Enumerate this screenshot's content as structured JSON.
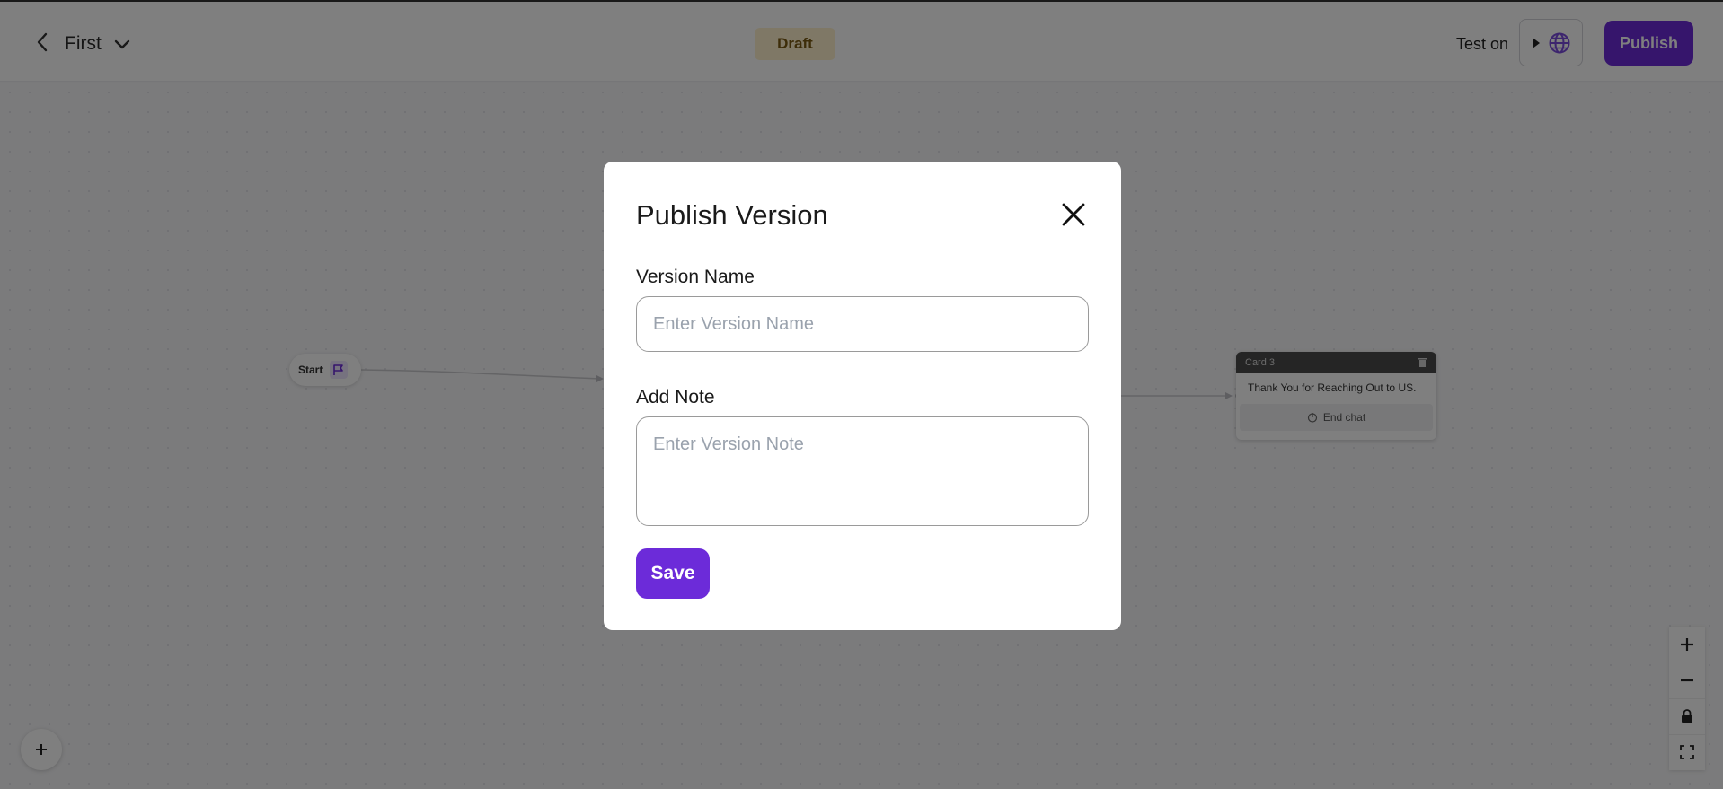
{
  "header": {
    "flow_name": "First",
    "status_badge": "Draft",
    "test_on_label": "Test on",
    "publish_label": "Publish"
  },
  "canvas": {
    "start_node_label": "Start",
    "card": {
      "title": "Card 3",
      "message": "Thank You for Reaching Out to US.",
      "end_action": "End chat"
    }
  },
  "modal": {
    "title": "Publish Version",
    "version_name_label": "Version Name",
    "version_name_placeholder": "Enter Version Name",
    "version_name_value": "",
    "note_label": "Add Note",
    "note_placeholder": "Enter Version Note",
    "note_value": "",
    "save_label": "Save"
  },
  "colors": {
    "accent": "#6c2bd9",
    "draft_badge_bg": "#fff1cc",
    "overlay": "rgba(0,0,0,0.5)"
  }
}
